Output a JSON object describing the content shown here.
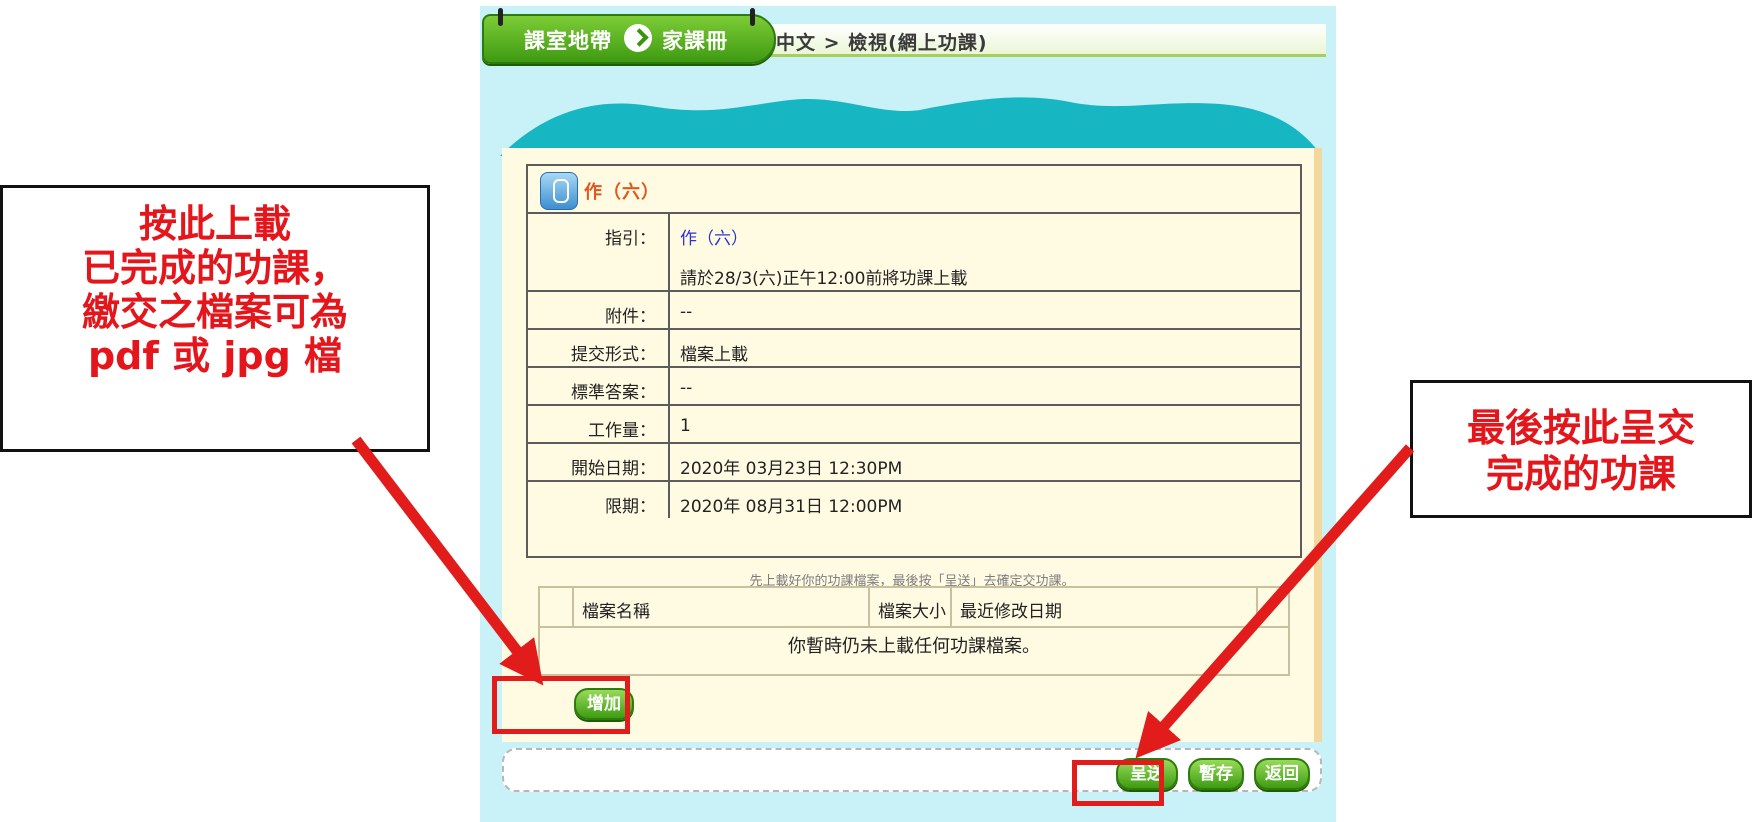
{
  "header": {
    "badge_section": "課室地帶",
    "badge_page": "家課冊",
    "breadcrumb": "中文 > 檢視(網上功課)"
  },
  "assignment": {
    "title": "作（六）",
    "rows": [
      {
        "label": "指引：",
        "value": "作（六）",
        "value2": "請於28/3(六)正午12:00前將功課上載"
      },
      {
        "label": "附件：",
        "value": "--"
      },
      {
        "label": "提交形式：",
        "value": "檔案上載"
      },
      {
        "label": "標準答案：",
        "value": "--"
      },
      {
        "label": "工作量：",
        "value": "1"
      },
      {
        "label": "開始日期：",
        "value": "2020年 03月23日  12:30PM"
      },
      {
        "label": "限期：",
        "value": "2020年 08月31日  12:00PM"
      }
    ]
  },
  "files": {
    "note": "先上載好你的功課檔案，最後按「呈送」去確定交功課。",
    "columns": [
      "檔案名稱",
      "檔案大小",
      "最近修改日期"
    ],
    "empty_message": "你暫時仍未上載任何功課檔案。",
    "add_label": "增加"
  },
  "actions": {
    "submit_label": "呈送",
    "save_label": "暫存",
    "back_label": "返回"
  },
  "annotations": {
    "left": [
      "按此上載",
      "已完成的功課，",
      "繳交之檔案可為",
      "pdf 或 jpg 檔"
    ],
    "right": [
      "最後按此呈交",
      "完成的功課"
    ]
  },
  "colors": {
    "annotation_red": "#e4161b",
    "accent_green": "#3f9a12",
    "background_cyan": "#c9f2f8",
    "card_cream": "#fffbe3",
    "hill_teal": "#17b6c3"
  }
}
